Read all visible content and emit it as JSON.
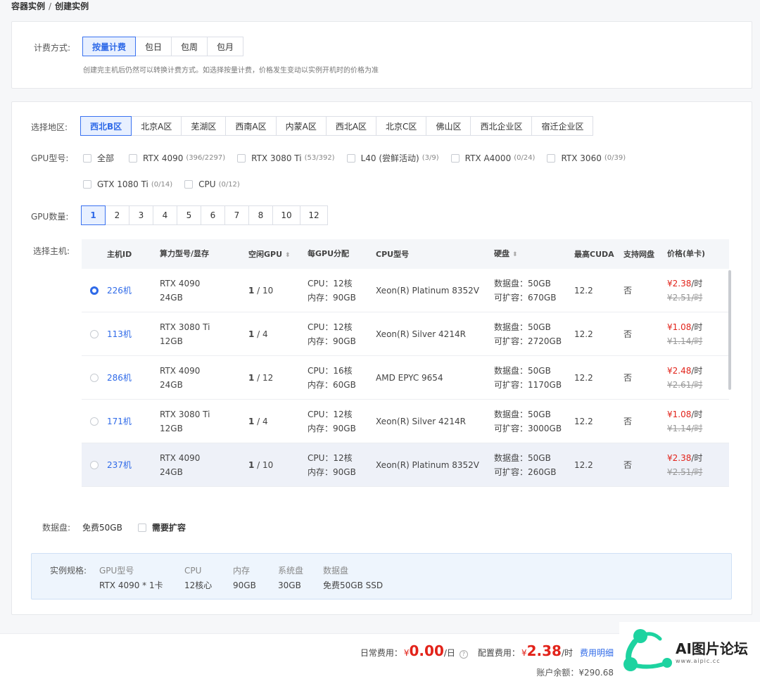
{
  "breadcrumb": {
    "parent": "容器实例",
    "sep": "/",
    "current": "创建实例"
  },
  "billing": {
    "label": "计费方式:",
    "options": [
      "按量计费",
      "包日",
      "包周",
      "包月"
    ],
    "active": 0,
    "hint": "创建完主机后仍然可以转换计费方式。如选择按量计费，价格发生变动以实例开机时的价格为准"
  },
  "region": {
    "label": "选择地区:",
    "options": [
      "西北B区",
      "北京A区",
      "芜湖区",
      "西南A区",
      "内蒙A区",
      "西北A区",
      "北京C区",
      "佛山区",
      "西北企业区",
      "宿迁企业区"
    ]
  },
  "gpu_model": {
    "label": "GPU型号:",
    "row1": [
      {
        "name": "全部",
        "count": ""
      },
      {
        "name": "RTX 4090",
        "count": "(396/2297)"
      },
      {
        "name": "RTX 3080 Ti",
        "count": "(53/392)"
      },
      {
        "name": "L40 (尝鲜活动)",
        "count": "(3/9)"
      },
      {
        "name": "RTX A4000",
        "count": "(0/24)"
      },
      {
        "name": "RTX 3060",
        "count": "(0/39)"
      }
    ],
    "row2": [
      {
        "name": "GTX 1080 Ti",
        "count": "(0/14)"
      },
      {
        "name": "CPU",
        "count": "(0/12)"
      }
    ]
  },
  "gpu_count": {
    "label": "GPU数量:",
    "options": [
      "1",
      "2",
      "3",
      "4",
      "5",
      "6",
      "7",
      "8",
      "10",
      "12"
    ]
  },
  "host": {
    "label": "选择主机:",
    "headers": {
      "id": "主机ID",
      "model": "算力型号/显存",
      "free_gpu": "空闲GPU",
      "per_gpu": "每GPU分配",
      "cpu": "CPU型号",
      "disk": "硬盘",
      "cuda": "最高CUDA",
      "netdisk": "支持网盘",
      "price": "价格(单卡)"
    },
    "rows": [
      {
        "id": "226机",
        "model": "RTX 4090",
        "vram": "24GB",
        "free_num": "1",
        "free_total": " / 10",
        "cpu_alloc": "CPU：12核",
        "mem_alloc": "内存：90GB",
        "cpu": "Xeon(R) Platinum 8352V",
        "disk_data": "数据盘：50GB",
        "disk_exp": "可扩容：670GB",
        "cuda": "12.2",
        "netdisk": "否",
        "price": "¥2.38",
        "unit": "/时",
        "old_price": "¥2.51/时"
      },
      {
        "id": "113机",
        "model": "RTX 3080 Ti",
        "vram": "12GB",
        "free_num": "1",
        "free_total": " / 4",
        "cpu_alloc": "CPU：12核",
        "mem_alloc": "内存：90GB",
        "cpu": "Xeon(R) Silver 4214R",
        "disk_data": "数据盘：50GB",
        "disk_exp": "可扩容：2720GB",
        "cuda": "12.2",
        "netdisk": "否",
        "price": "¥1.08",
        "unit": "/时",
        "old_price": "¥1.14/时"
      },
      {
        "id": "286机",
        "model": "RTX 4090",
        "vram": "24GB",
        "free_num": "1",
        "free_total": " / 12",
        "cpu_alloc": "CPU：16核",
        "mem_alloc": "内存：60GB",
        "cpu": "AMD EPYC 9654",
        "disk_data": "数据盘：50GB",
        "disk_exp": "可扩容：1170GB",
        "cuda": "12.2",
        "netdisk": "否",
        "price": "¥2.48",
        "unit": "/时",
        "old_price": "¥2.61/时"
      },
      {
        "id": "171机",
        "model": "RTX 3080 Ti",
        "vram": "12GB",
        "free_num": "1",
        "free_total": " / 4",
        "cpu_alloc": "CPU：12核",
        "mem_alloc": "内存：90GB",
        "cpu": "Xeon(R) Silver 4214R",
        "disk_data": "数据盘：50GB",
        "disk_exp": "可扩容：3000GB",
        "cuda": "12.2",
        "netdisk": "否",
        "price": "¥1.08",
        "unit": "/时",
        "old_price": "¥1.14/时"
      },
      {
        "id": "237机",
        "model": "RTX 4090",
        "vram": "24GB",
        "free_num": "1",
        "free_total": " / 10",
        "cpu_alloc": "CPU：12核",
        "mem_alloc": "内存：90GB",
        "cpu": "Xeon(R) Platinum 8352V",
        "disk_data": "数据盘：50GB",
        "disk_exp": "可扩容：260GB",
        "cuda": "12.2",
        "netdisk": "否",
        "price": "¥2.38",
        "unit": "/时",
        "old_price": "¥2.51/时"
      }
    ]
  },
  "data_disk": {
    "label": "数据盘:",
    "free": "免费50GB",
    "expand": "需要扩容"
  },
  "spec": {
    "label": "实例规格:",
    "cols": [
      {
        "h": "GPU型号",
        "v": "RTX 4090 * 1卡"
      },
      {
        "h": "CPU",
        "v": "12核心"
      },
      {
        "h": "内存",
        "v": "90GB"
      },
      {
        "h": "系统盘",
        "v": "30GB"
      },
      {
        "h": "数据盘",
        "v": "免费50GB SSD"
      }
    ]
  },
  "footer": {
    "daily_label": "日常费用：",
    "daily_yen": "¥",
    "daily_value": "0.00",
    "daily_unit": "/日",
    "config_label": "配置费用：",
    "config_yen": "¥",
    "config_value": "2.38",
    "config_unit": "/时",
    "detail_link": "费用明细",
    "balance": "账户余额：¥290.68"
  },
  "watermark": {
    "title": "AI图片论坛",
    "sub": "www.aipic.cc"
  },
  "colors": {
    "accent": "#2f6ae8",
    "price": "#e2231a",
    "logo_green": "#1dd3a0"
  }
}
